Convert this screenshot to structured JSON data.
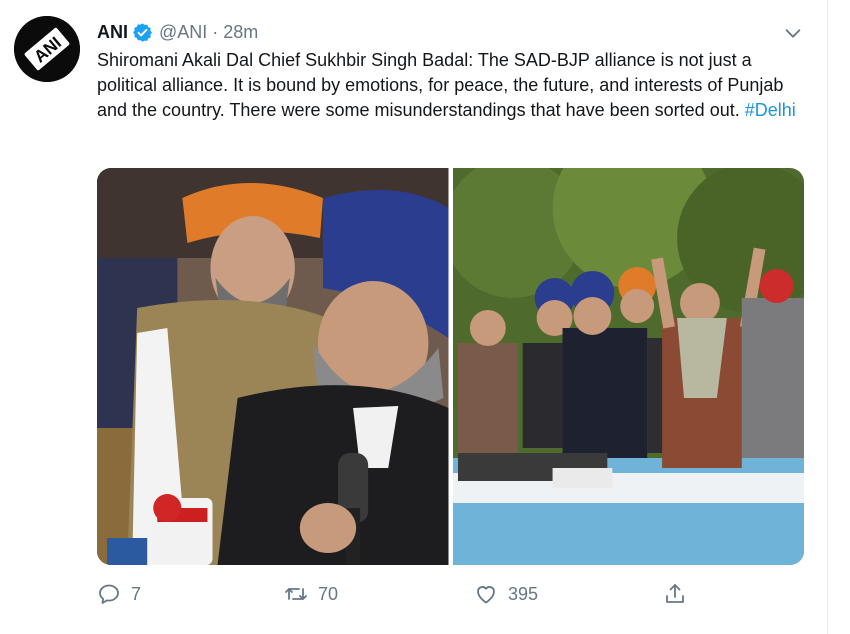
{
  "tweet": {
    "author_name": "ANI",
    "handle": "@ANI",
    "separator": "·",
    "time": "28m",
    "text": "Shiromani Akali Dal Chief Sukhbir Singh Badal: The SAD-BJP alliance is not just a political alliance. It is bound by emotions, for peace, the future, and interests of Punjab and the country. There were some misunderstandings that have been sorted out.",
    "hashtag": "#Delhi",
    "avatar_text": "ANI"
  },
  "actions": {
    "replies": "7",
    "retweets": "70",
    "likes": "395"
  },
  "icons": {
    "verified": "verified-badge-icon",
    "caret": "chevron-down-icon",
    "reply": "reply-icon",
    "retweet": "retweet-icon",
    "like": "heart-icon",
    "share": "share-icon"
  },
  "colors": {
    "link": "#1b95e0",
    "secondary": "#657786",
    "verified": "#1da1f2"
  }
}
